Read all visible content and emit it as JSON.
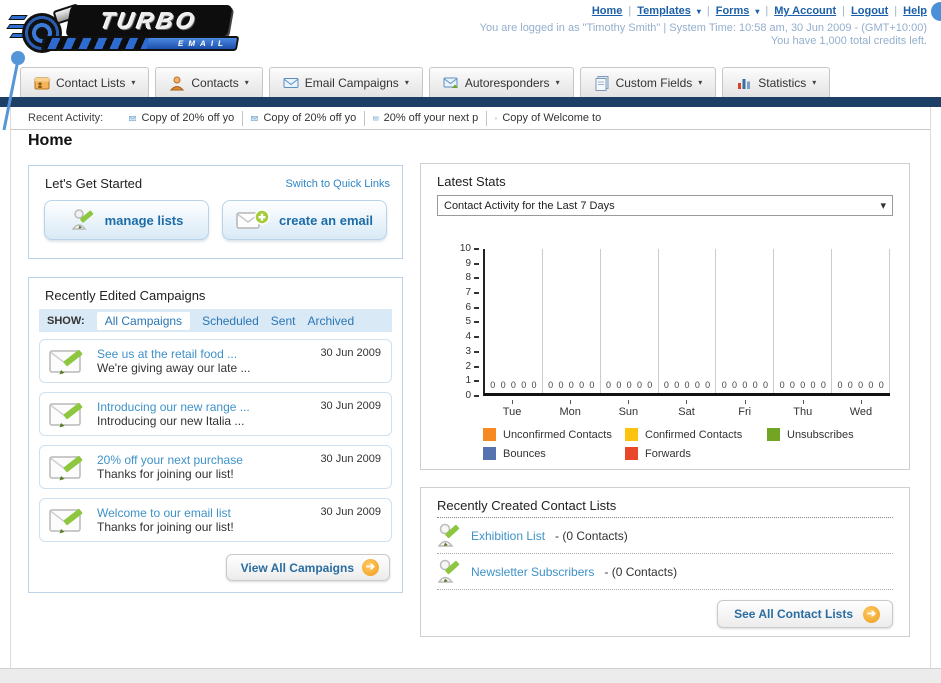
{
  "header": {
    "logo_line1": "TURBO",
    "logo_line2": "EMAIL",
    "nav_links": [
      "Home",
      "Templates",
      "Forms",
      "My Account",
      "Logout",
      "Help"
    ],
    "login_info": "You are logged in as \"Timothy Smith\" | System Time: 10:58 am, 30 Jun 2009 - (GMT+10:00)",
    "credits_info": "You have 1,000 total credits left."
  },
  "tabs": [
    {
      "label": "Contact Lists"
    },
    {
      "label": "Contacts"
    },
    {
      "label": "Email Campaigns"
    },
    {
      "label": "Autoresponders"
    },
    {
      "label": "Custom Fields"
    },
    {
      "label": "Statistics"
    }
  ],
  "recent_activity": {
    "label": "Recent Activity:",
    "items": [
      "Copy of 20% off yo",
      "Copy of 20% off yo",
      "20% off your next p",
      "Copy of Welcome to"
    ]
  },
  "page_title": "Home",
  "get_started": {
    "title": "Let's Get Started",
    "switch_link": "Switch to Quick Links",
    "manage_lists_label": "manage lists",
    "create_email_label": "create an email"
  },
  "campaigns": {
    "title": "Recently Edited Campaigns",
    "show_label": "SHOW:",
    "filters": [
      "All Campaigns",
      "Scheduled",
      "Sent",
      "Archived"
    ],
    "active_filter": "All Campaigns",
    "items": [
      {
        "title": "See us at the retail food ...",
        "subtitle": "We're giving away our late ...",
        "date": "30 Jun 2009"
      },
      {
        "title": "Introducing our new range ...",
        "subtitle": "Introducing our new Italia ...",
        "date": "30 Jun 2009"
      },
      {
        "title": "20% off your next purchase",
        "subtitle": "Thanks for joining our list!",
        "date": "30 Jun 2009"
      },
      {
        "title": "Welcome to our email list",
        "subtitle": "Thanks for joining our list!",
        "date": "30 Jun 2009"
      }
    ],
    "view_all_label": "View All Campaigns"
  },
  "stats": {
    "title": "Latest Stats",
    "dropdown_value": "Contact Activity for the Last 7 Days"
  },
  "chart_data": {
    "type": "bar",
    "title": "Contact Activity for the Last 7 Days",
    "categories": [
      "Tue",
      "Mon",
      "Sun",
      "Sat",
      "Fri",
      "Thu",
      "Wed"
    ],
    "series": [
      {
        "name": "Unconfirmed Contacts",
        "color": "#f6891f",
        "values": [
          0,
          0,
          0,
          0,
          0,
          0,
          0
        ]
      },
      {
        "name": "Confirmed Contacts",
        "color": "#fdc40f",
        "values": [
          0,
          0,
          0,
          0,
          0,
          0,
          0
        ]
      },
      {
        "name": "Unsubscribes",
        "color": "#72a523",
        "values": [
          0,
          0,
          0,
          0,
          0,
          0,
          0
        ]
      },
      {
        "name": "Bounces",
        "color": "#5573ae",
        "values": [
          0,
          0,
          0,
          0,
          0,
          0,
          0
        ]
      },
      {
        "name": "Forwards",
        "color": "#e8472a",
        "values": [
          0,
          0,
          0,
          0,
          0,
          0,
          0
        ]
      }
    ],
    "ylim": [
      0,
      10
    ],
    "ytick_step": 1,
    "grid": "vertical",
    "legend_position": "bottom"
  },
  "contact_lists": {
    "title": "Recently Created Contact Lists",
    "items": [
      {
        "name": "Exhibition List",
        "suffix": "- (0 Contacts)"
      },
      {
        "name": "Newsletter Subscribers",
        "suffix": "- (0 Contacts)"
      }
    ],
    "see_all_label": "See All Contact Lists"
  },
  "colors": {
    "navy_bar": "#1d3f66",
    "accent_orange": "#ef9d1f",
    "link_blue": "#2a76b5"
  }
}
